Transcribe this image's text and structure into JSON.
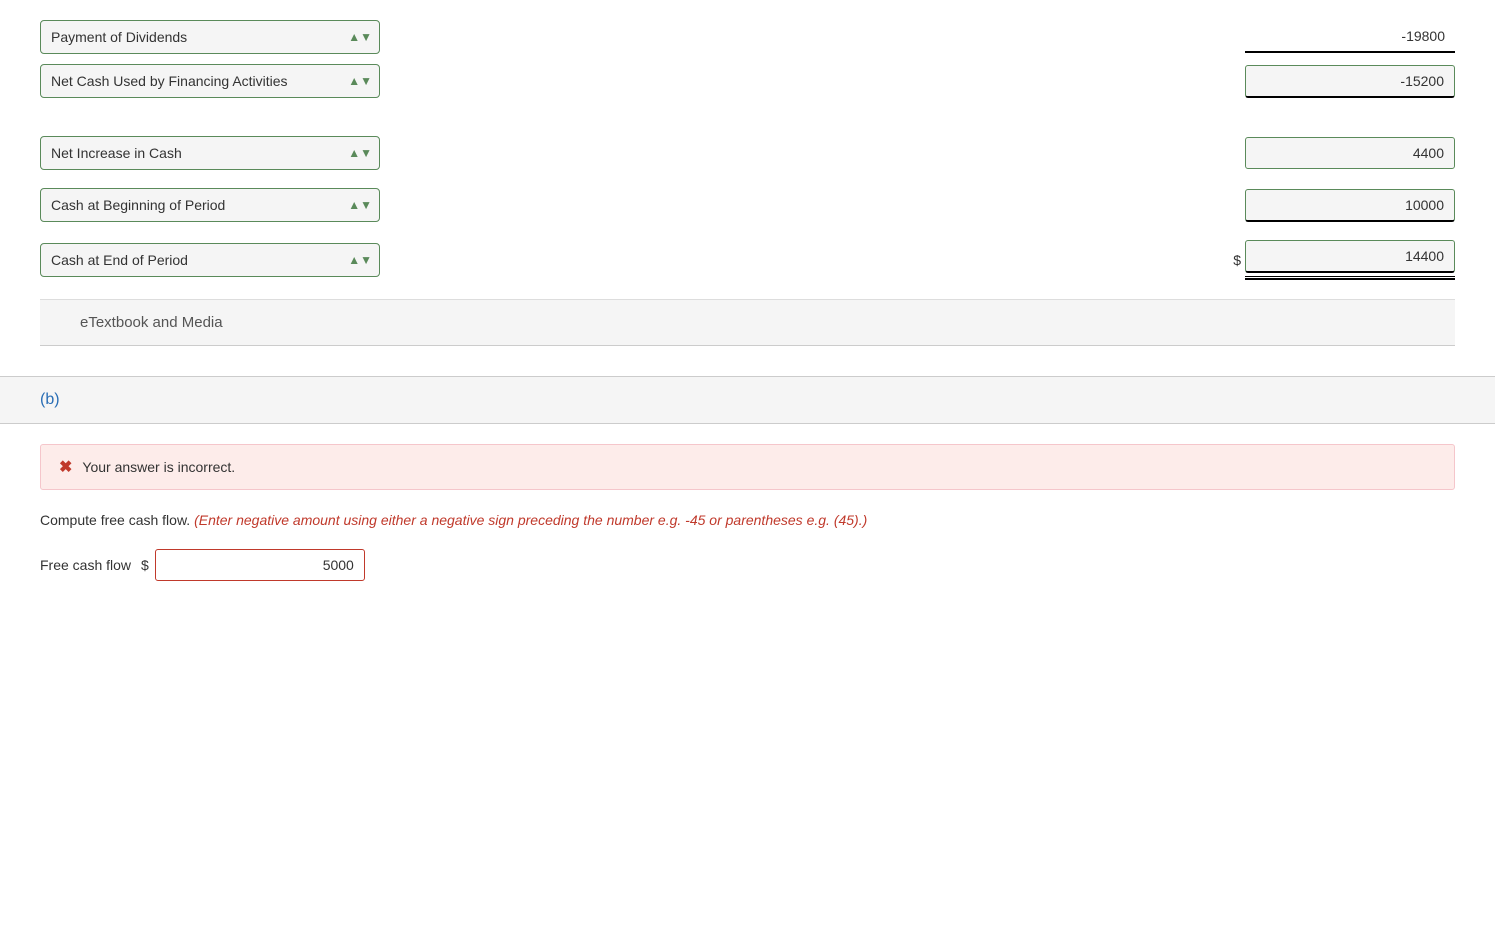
{
  "sectionA": {
    "rows": [
      {
        "id": "payment-dividends",
        "label": "Payment of Dividends",
        "value": "-19800",
        "inputType": "underline"
      },
      {
        "id": "net-cash-financing",
        "label": "Net Cash Used by Financing Activities",
        "value": "-15200",
        "inputType": "normal"
      },
      {
        "id": "net-increase-cash",
        "label": "Net Increase in Cash",
        "value": "4400",
        "inputType": "normal"
      },
      {
        "id": "cash-beginning",
        "label": "Cash at Beginning of Period",
        "value": "10000",
        "inputType": "normal"
      },
      {
        "id": "cash-end",
        "label": "Cash at End of Period",
        "value": "14400",
        "inputType": "double-underline",
        "showDollar": true
      }
    ],
    "etextbook": "eTextbook and Media"
  },
  "sectionB": {
    "label": "(b)",
    "errorMessage": "Your answer is incorrect.",
    "instructions": "Compute free cash flow.",
    "hint": "(Enter negative amount using either a negative sign preceding the number e.g. -45 or parentheses e.g. (45).)",
    "freeCashFlowLabel": "Free cash flow",
    "dollarSign": "$",
    "freeCashFlowValue": "5000"
  }
}
